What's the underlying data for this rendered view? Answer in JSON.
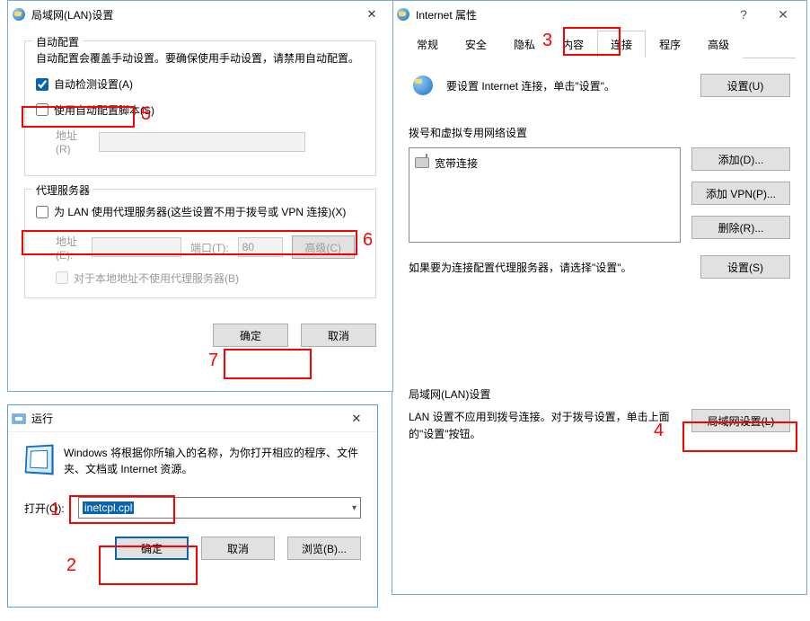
{
  "inet": {
    "title": "Internet 属性",
    "tabs": {
      "general": "常规",
      "security": "安全",
      "privacy": "隐私",
      "content": "内容",
      "connections": "连接",
      "programs": "程序",
      "advanced": "高级"
    },
    "setup": {
      "text": "要设置 Internet 连接，单击\"设置\"。",
      "button": "设置(U)"
    },
    "dialup": {
      "legend": "拨号和虚拟专用网络设置",
      "item": "宽带连接",
      "add": "添加(D)...",
      "add_vpn": "添加 VPN(P)...",
      "remove": "删除(R)...",
      "proxy_text": "如果要为连接配置代理服务器，请选择\"设置\"。",
      "settings": "设置(S)"
    },
    "lan_section": {
      "legend": "局域网(LAN)设置",
      "text": "LAN 设置不应用到拨号连接。对于拨号设置，单击上面的\"设置\"按钮。",
      "button": "局域网设置(L)"
    }
  },
  "lan": {
    "title": "局域网(LAN)设置",
    "auto": {
      "legend": "自动配置",
      "desc": "自动配置会覆盖手动设置。要确保使用手动设置，请禁用自动配置。",
      "detect": "自动检测设置(A)",
      "script": "使用自动配置脚本(S)",
      "addr_label": "地址(R)"
    },
    "proxy": {
      "legend": "代理服务器",
      "use": "为 LAN 使用代理服务器(这些设置不用于拨号或 VPN 连接)(X)",
      "addr_label": "地址(E):",
      "port_label": "端口(T):",
      "port_value": "80",
      "advanced": "高级(C)",
      "bypass": "对于本地地址不使用代理服务器(B)"
    },
    "ok": "确定",
    "cancel": "取消"
  },
  "run": {
    "title": "运行",
    "desc": "Windows 将根据你所输入的名称，为你打开相应的程序、文件夹、文档或 Internet 资源。",
    "open_label": "打开(O):",
    "value": "inetcpl.cpl",
    "ok": "确定",
    "cancel": "取消",
    "browse": "浏览(B)..."
  },
  "annotations": {
    "n1": "1",
    "n2": "2",
    "n3": "3",
    "n4": "4",
    "n5": "5",
    "n6": "6",
    "n7": "7"
  }
}
